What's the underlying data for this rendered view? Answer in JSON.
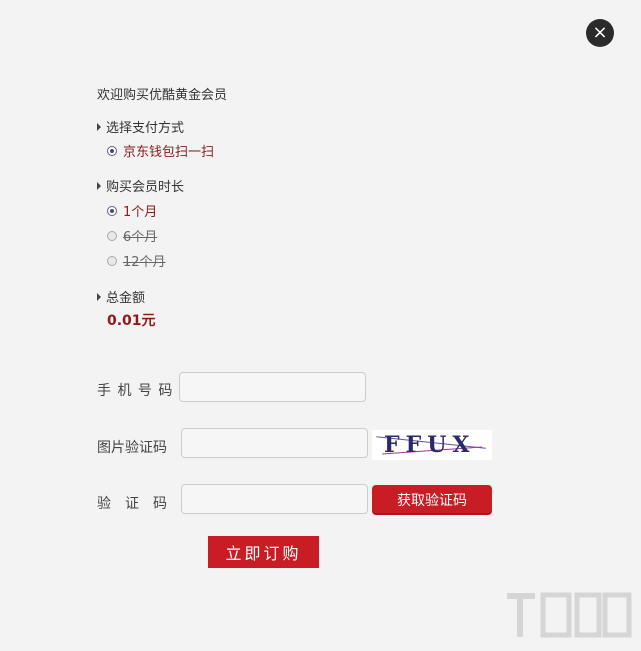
{
  "close_icon": "×",
  "title": "欢迎购买优酷黄金会员",
  "payment": {
    "heading": "选择支付方式",
    "options": [
      {
        "label": "京东钱包扫一扫",
        "selected": true
      }
    ]
  },
  "duration": {
    "heading": "购买会员时长",
    "options": [
      {
        "label": "1个月",
        "selected": true
      },
      {
        "label": "6个月",
        "selected": false
      },
      {
        "label": "12个月",
        "selected": false
      }
    ]
  },
  "total": {
    "heading": "总金额",
    "amount": "0.01元"
  },
  "form": {
    "phone_label": "手 机 号 码",
    "phone_value": "",
    "captcha_label": "图片验证码",
    "captcha_value": "",
    "captcha_image_text": "FFUX",
    "code_label": "验　证　码",
    "code_value": "",
    "get_code_button": "获取验证码"
  },
  "submit_button": "立即订购",
  "colors": {
    "accent": "#c81d25",
    "price": "#8b1a1a",
    "background": "#f3f3f3"
  }
}
